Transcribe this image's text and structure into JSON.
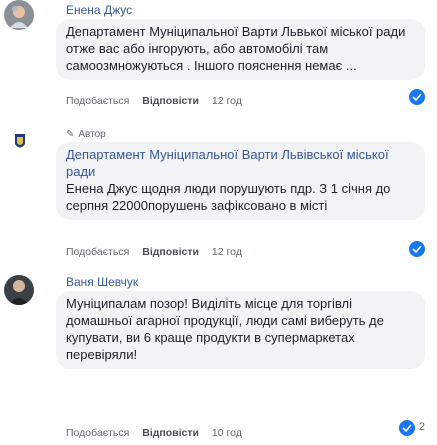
{
  "comments": [
    {
      "author": "Енена Джус",
      "text": "Департамент Муніципальної Варти Львької міської ради отже вас або інгорують, або автомобілі там самоозмножуються . Іншого пояснення немає ...",
      "actions": {
        "like": "Подобається",
        "reply": "Відповісти",
        "time": "12 год"
      }
    },
    {
      "tag": "Автор",
      "author": "Департамент Муніципальної Варти Львівської міської ради",
      "text": "Енена Джус щодня люди порушують пдр. З 1 січня до серпня 22000порушень зафіксовано в місті",
      "actions": {
        "like": "Подобається",
        "reply": "Відповісти",
        "time": "12 год"
      }
    },
    {
      "author": "Ваня Шевчук",
      "text": "Муніципалам позор! Виділіть місце для торгівлі домашньої агарної продукції, люди самі виберуть де купувати, ви 6 краще продукти в супермаркетах перевіряли!",
      "actions": {
        "like": "Подобається",
        "reply": "Відповісти",
        "time": "10 год"
      },
      "reactions": "2"
    }
  ]
}
